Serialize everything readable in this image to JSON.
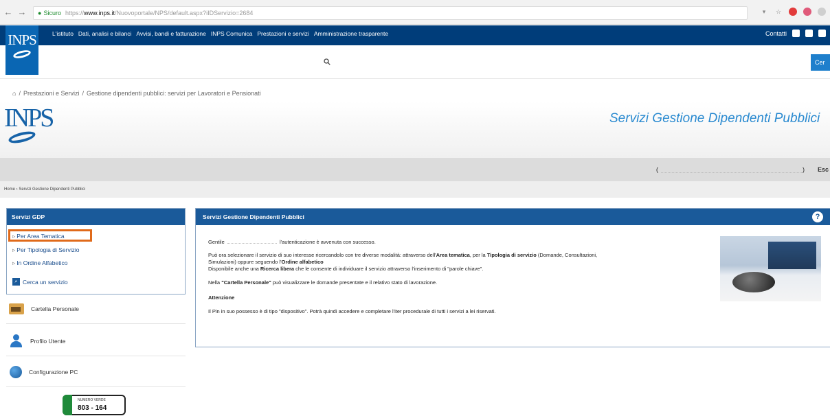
{
  "browser": {
    "secure_label": "Sicuro",
    "url_scheme": "https://",
    "url_host": "www.inps.it",
    "url_path": "/Nuovoportale/NPS/default.aspx?iIDServizio=2684"
  },
  "topnav": {
    "links": [
      "L'istituto",
      "Dati, analisi e bilanci",
      "Avvisi, bandi e fatturazione",
      "INPS Comunica",
      "Prestazioni e servizi",
      "Amministrazione trasparente"
    ],
    "contacts": "Contatti",
    "logo": "INPS"
  },
  "search": {
    "button_label": "Cer"
  },
  "breadcrumb_top": {
    "items": [
      "Prestazioni e Servizi",
      "Gestione dipendenti pubblici: servizi per Lavoratori e Pensionati"
    ],
    "separator": "/"
  },
  "service": {
    "logo": "INPS",
    "title": "Servizi Gestione Dipendenti Pubblici"
  },
  "userbar": {
    "prefix": "(",
    "suffix": ")",
    "exit": "Esc"
  },
  "breadcrumb_small": "Home › Servizi Gestione Dipendenti Pubblici",
  "sidebar": {
    "box_title": "Servizi GDP",
    "items": [
      "Per Area Tematica",
      "Per Tipologia di Servizio",
      "In Ordine Alfabetico"
    ],
    "search_link": "Cerca un servizio",
    "links": [
      "Cartella Personale",
      "Profilo Utente",
      "Configurazione PC"
    ],
    "contact_small": "NUMERO VERDE",
    "contact_number": "803 - 164"
  },
  "main": {
    "title": "Servizi Gestione Dipendenti Pubblici",
    "help": "?",
    "greeting_prefix": "Gentile",
    "greeting_suffix": "l'autenticazione è avvenuta con successo.",
    "line1_a": "Può ora selezionare il servizio di suo interesse ricercandolo con tre diverse modalità: attraverso dell'",
    "line1_b": "Area tematica",
    "line1_c": ", per la ",
    "line1_d": "Tipologia di servizio",
    "line1_e": " (Domande, Consultazioni,",
    "line2_a": "Simulazioni) oppure seguendo l'",
    "line2_b": "Ordine alfabetico",
    "line3_a": "Disponibile anche una ",
    "line3_b": "Ricerca libera",
    "line3_c": " che le consente di individuare il servizio attraverso l'inserimento di \"parole chiave\".",
    "line4_a": "Nella ",
    "line4_b": "\"Cartella Personale\"",
    "line4_c": " può visualizzare le domande presentate e il relativo stato di lavorazione.",
    "attention": "Attenzione",
    "line5": "Il Pin in suo possesso è di tipo \"dispositivo\". Potrà quindi accedere e completare l'iter procedurale di tutti i servizi a lei riservati."
  },
  "colors": {
    "nav_blue": "#003d7a",
    "panel_blue": "#1a5a9a",
    "title_blue": "#2a8ad0",
    "highlight": "#e06a1a"
  }
}
